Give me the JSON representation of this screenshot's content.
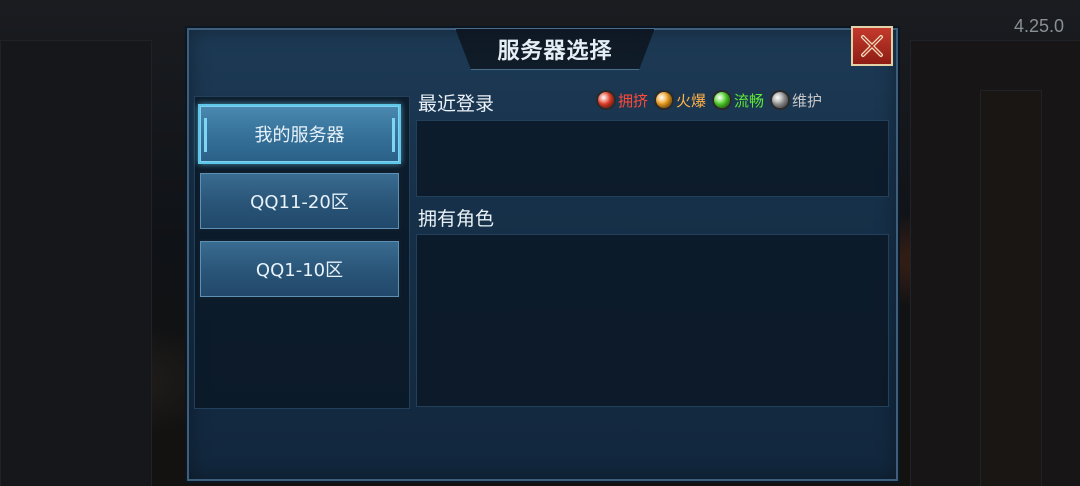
{
  "version": "4.25.0",
  "dialog": {
    "title": "服务器选择",
    "close_icon": "close-x-icon"
  },
  "server_list": [
    {
      "label": "我的服务器",
      "active": true
    },
    {
      "label": "QQ11-20区",
      "active": false
    },
    {
      "label": "QQ1-10区",
      "active": false
    }
  ],
  "recent_login": {
    "label": "最近登录"
  },
  "owned_roles": {
    "label": "拥有角色"
  },
  "legend": [
    {
      "label": "拥挤",
      "color": "#e8402a",
      "text_color": "#ff4a3a"
    },
    {
      "label": "火爆",
      "color": "#f0a020",
      "text_color": "#ffb24a"
    },
    {
      "label": "流畅",
      "color": "#4fd12a",
      "text_color": "#5fe83a"
    },
    {
      "label": "维护",
      "color": "#9a9a9a",
      "text_color": "#c8c8c8"
    }
  ]
}
